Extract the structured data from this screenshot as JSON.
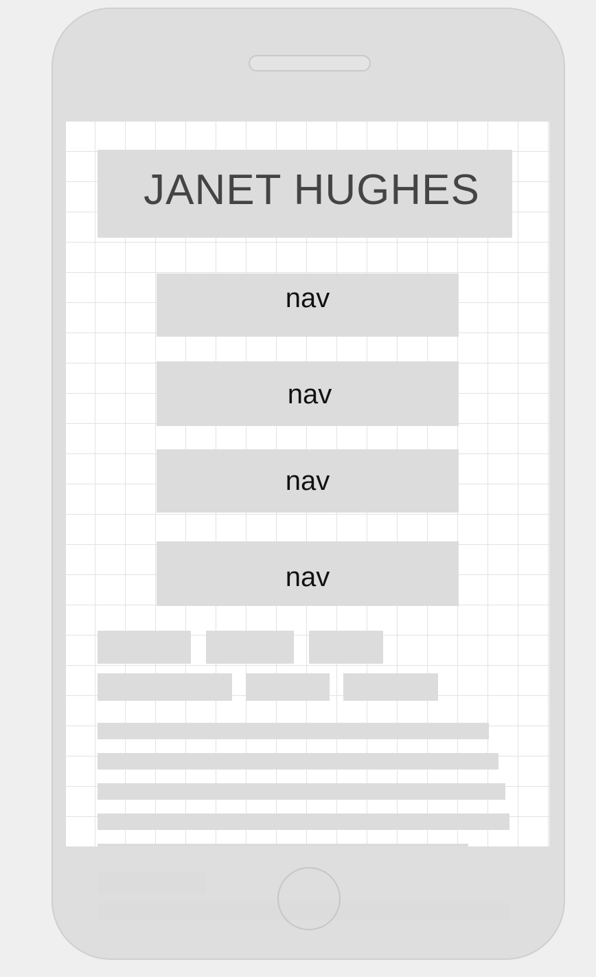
{
  "header": {
    "title": "JANET HUGHES"
  },
  "nav": [
    {
      "label": "nav"
    },
    {
      "label": "nav"
    },
    {
      "label": "nav"
    },
    {
      "label": "nav"
    }
  ],
  "colors": {
    "background": "#efefef",
    "device": "#dedede",
    "placeholder": "#dcdcdc",
    "grid_line": "#e2e2e2",
    "title_text": "#444444",
    "nav_text": "#111111"
  },
  "icons": {
    "speaker": "speaker-slot",
    "home": "home-button-circle"
  }
}
